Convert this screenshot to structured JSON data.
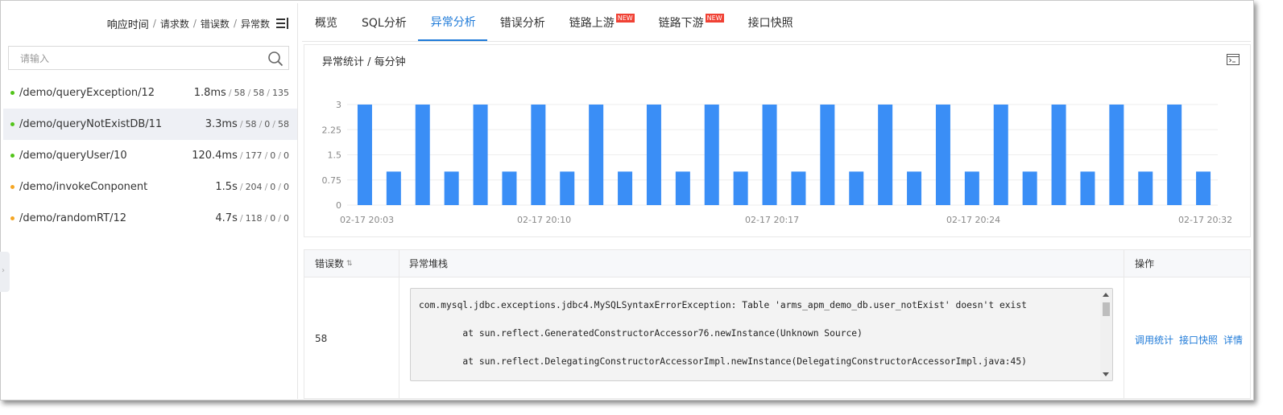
{
  "sidebar": {
    "sort_options": [
      "响应时间",
      "请求数",
      "错误数",
      "异常数"
    ],
    "search_placeholder": "请输入",
    "items": [
      {
        "path": "/demo/queryException/12",
        "rt": "1.8ms",
        "requests": "58",
        "errors": "58",
        "exceptions": "135",
        "status_color": "#52c41a",
        "selected": false
      },
      {
        "path": "/demo/queryNotExistDB/11",
        "rt": "3.3ms",
        "requests": "58",
        "errors": "0",
        "exceptions": "58",
        "status_color": "#52c41a",
        "selected": true
      },
      {
        "path": "/demo/queryUser/10",
        "rt": "120.4ms",
        "requests": "177",
        "errors": "0",
        "exceptions": "0",
        "status_color": "#52c41a",
        "selected": false
      },
      {
        "path": "/demo/invokeConponent",
        "rt": "1.5s",
        "requests": "204",
        "errors": "0",
        "exceptions": "0",
        "status_color": "#f5a623",
        "selected": false
      },
      {
        "path": "/demo/randomRT/12",
        "rt": "4.7s",
        "requests": "118",
        "errors": "0",
        "exceptions": "0",
        "status_color": "#f5a623",
        "selected": false
      }
    ]
  },
  "tabs": [
    {
      "label": "概览",
      "active": false,
      "badge": ""
    },
    {
      "label": "SQL分析",
      "active": false,
      "badge": ""
    },
    {
      "label": "异常分析",
      "active": true,
      "badge": ""
    },
    {
      "label": "错误分析",
      "active": false,
      "badge": ""
    },
    {
      "label": "链路上游",
      "active": false,
      "badge": "NEW"
    },
    {
      "label": "链路下游",
      "active": false,
      "badge": "NEW"
    },
    {
      "label": "接口快照",
      "active": false,
      "badge": ""
    }
  ],
  "chart": {
    "title": "异常统计 / 每分钟",
    "tool_icon": "terminal-window-icon"
  },
  "chart_data": {
    "type": "bar",
    "title": "异常统计 / 每分钟",
    "xlabel": "",
    "ylabel": "",
    "ylim": [
      0,
      3
    ],
    "yticks": [
      "0",
      "0.75",
      "1.5",
      "2.25",
      "3"
    ],
    "xtick_labels": [
      "02-17 20:03",
      "02-17 20:10",
      "02-17 20:17",
      "02-17 20:24",
      "02-17 20:32"
    ],
    "bar_color": "#3a8ef6",
    "grid": true,
    "values": [
      3,
      1,
      3,
      1,
      3,
      1,
      3,
      1,
      3,
      1,
      3,
      1,
      3,
      1,
      3,
      1,
      3,
      1,
      3,
      1,
      3,
      1,
      3,
      1,
      3,
      1,
      3,
      1,
      3,
      1
    ]
  },
  "table": {
    "headers": {
      "count": "错误数",
      "stack": "异常堆栈",
      "actions": "操作"
    },
    "rows": [
      {
        "count": "58",
        "stack": [
          "com.mysql.jdbc.exceptions.jdbc4.MySQLSyntaxErrorException: Table 'arms_apm_demo_db.user_notExist' doesn't exist",
          "        at sun.reflect.GeneratedConstructorAccessor76.newInstance(Unknown Source)",
          "        at sun.reflect.DelegatingConstructorAccessorImpl.newInstance(DelegatingConstructorAccessorImpl.java:45)"
        ],
        "actions": [
          "调用统计",
          "接口快照",
          "详情"
        ]
      }
    ]
  },
  "colors": {
    "accent": "#1e7ad8",
    "badge": "#f04134",
    "ok": "#52c41a",
    "warn": "#f5a623"
  }
}
